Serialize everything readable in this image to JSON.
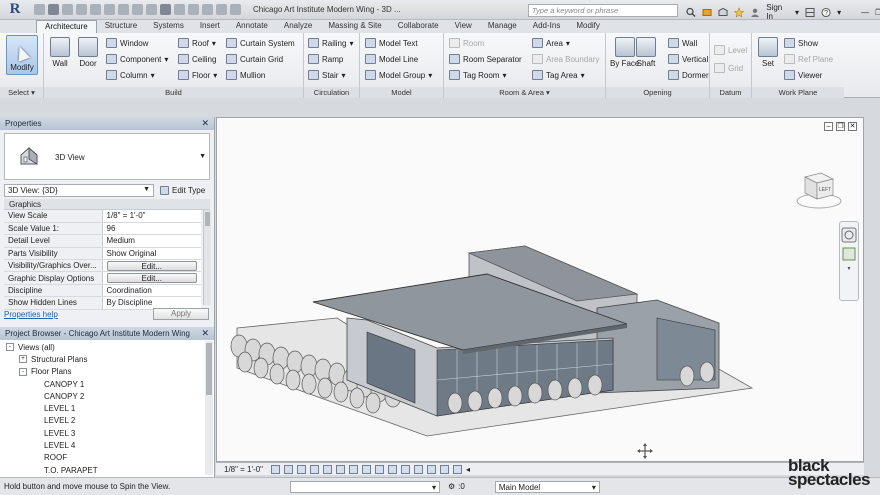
{
  "titlebar": {
    "app_letter": "R",
    "document_title": "Chicago Art Institute Modern Wing - 3D ...",
    "search_placeholder": "Type a keyword or phrase",
    "sign_in": "Sign In"
  },
  "ribbon_tabs": [
    "Architecture",
    "Structure",
    "Systems",
    "Insert",
    "Annotate",
    "Analyze",
    "Massing & Site",
    "Collaborate",
    "View",
    "Manage",
    "Add-Ins",
    "Modify"
  ],
  "ribbon": {
    "select": {
      "modify": "Modify",
      "label": "Select"
    },
    "build": {
      "label": "Build",
      "wall": "Wall",
      "door": "Door",
      "window": "Window",
      "component": "Component",
      "column": "Column",
      "roof": "Roof",
      "ceiling": "Ceiling",
      "floor": "Floor",
      "curtain_system": "Curtain System",
      "curtain_grid": "Curtain Grid",
      "mullion": "Mullion"
    },
    "circulation": {
      "label": "Circulation",
      "railing": "Railing",
      "ramp": "Ramp",
      "stair": "Stair"
    },
    "model": {
      "label": "Model",
      "text": "Model Text",
      "line": "Model Line",
      "group": "Model Group"
    },
    "room_area": {
      "label": "Room & Area",
      "room": "Room",
      "room_separator": "Room Separator",
      "tag_room": "Tag Room",
      "area": "Area",
      "area_boundary": "Area Boundary",
      "tag_area": "Tag Area"
    },
    "opening": {
      "label": "Opening",
      "by_face": "By Face",
      "shaft": "Shaft",
      "wall": "Wall",
      "vertical": "Vertical",
      "dormer": "Dormer"
    },
    "datum": {
      "label": "Datum",
      "level": "Level",
      "grid": "Grid"
    },
    "work_plane": {
      "label": "Work Plane",
      "set": "Set",
      "show": "Show",
      "ref_plane": "Ref Plane",
      "viewer": "Viewer"
    }
  },
  "properties": {
    "title": "Properties",
    "type_name": "3D View",
    "selector": "3D View: {3D}",
    "edit_type": "Edit Type",
    "group": "Graphics",
    "rows": [
      {
        "key": "View Scale",
        "value": "1/8\" = 1'-0\"",
        "button": false
      },
      {
        "key": "Scale Value    1:",
        "value": "96",
        "button": false
      },
      {
        "key": "Detail Level",
        "value": "Medium",
        "button": false
      },
      {
        "key": "Parts Visibility",
        "value": "Show Original",
        "button": false
      },
      {
        "key": "Visibility/Graphics Over...",
        "value": "Edit...",
        "button": true
      },
      {
        "key": "Graphic Display Options",
        "value": "Edit...",
        "button": true
      },
      {
        "key": "Discipline",
        "value": "Coordination",
        "button": false
      },
      {
        "key": "Show Hidden Lines",
        "value": "By Discipline",
        "button": false
      }
    ],
    "help": "Properties help",
    "apply": "Apply"
  },
  "browser": {
    "title": "Project Browser - Chicago Art Institute Modern Wing",
    "nodes": [
      {
        "label": "Views (all)",
        "level": 0,
        "expander": "-"
      },
      {
        "label": "Structural Plans",
        "level": 1,
        "expander": "+"
      },
      {
        "label": "Floor Plans",
        "level": 1,
        "expander": "-"
      },
      {
        "label": "CANOPY 1",
        "level": 2,
        "expander": ""
      },
      {
        "label": "CANOPY 2",
        "level": 2,
        "expander": ""
      },
      {
        "label": "LEVEL 1",
        "level": 2,
        "expander": ""
      },
      {
        "label": "LEVEL 2",
        "level": 2,
        "expander": ""
      },
      {
        "label": "LEVEL 3",
        "level": 2,
        "expander": ""
      },
      {
        "label": "LEVEL 4",
        "level": 2,
        "expander": ""
      },
      {
        "label": "ROOF",
        "level": 2,
        "expander": ""
      },
      {
        "label": "T.O. PARAPET",
        "level": 2,
        "expander": ""
      }
    ]
  },
  "viewport": {
    "viewcube_face": "LEFT"
  },
  "view_control": {
    "scale": "1/8\" = 1'-0\""
  },
  "status": {
    "message": "Hold button and move mouse to Spin the View.",
    "zero": ":0",
    "model": "Main Model"
  },
  "watermark": {
    "line1": "black",
    "line2": "spectacles"
  }
}
